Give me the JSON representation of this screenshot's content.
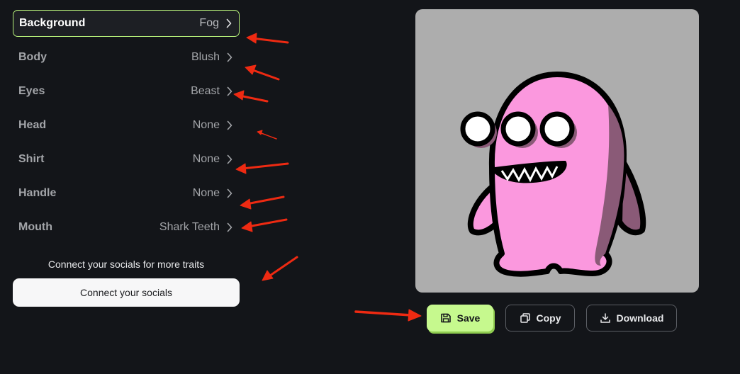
{
  "traits": [
    {
      "name": "Background",
      "value": "Fog",
      "active": true
    },
    {
      "name": "Body",
      "value": "Blush",
      "active": false
    },
    {
      "name": "Eyes",
      "value": "Beast",
      "active": false
    },
    {
      "name": "Head",
      "value": "None",
      "active": false
    },
    {
      "name": "Shirt",
      "value": "None",
      "active": false
    },
    {
      "name": "Handle",
      "value": "None",
      "active": false
    },
    {
      "name": "Mouth",
      "value": "Shark Teeth",
      "active": false
    }
  ],
  "connect": {
    "hint": "Connect your socials for more traits",
    "button_label": "Connect your socials"
  },
  "actions": {
    "save_label": "Save",
    "copy_label": "Copy",
    "download_label": "Download"
  },
  "colors": {
    "background": "#131519",
    "accent": "#c6f98e",
    "active_border": "#b6f07a",
    "preview_bg": "#adadad",
    "character_body": "#fb98de",
    "annotation_arrow": "#ee2a12"
  },
  "icons": {
    "chevron": "chevron-right-icon",
    "save": "floppy-disk-icon",
    "copy": "copy-icon",
    "download": "download-icon"
  }
}
